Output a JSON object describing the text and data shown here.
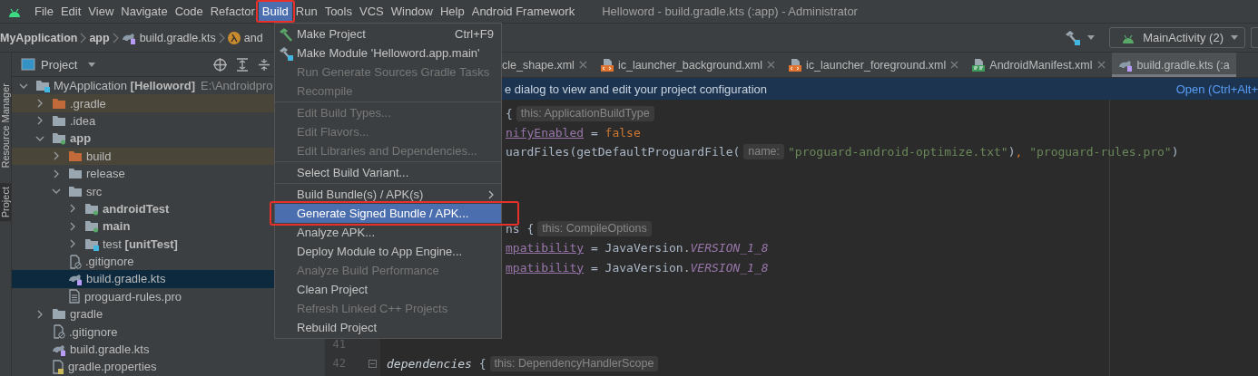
{
  "window": {
    "title": "Helloword - build.gradle.kts (:app) - Administrator"
  },
  "menu_bar": [
    {
      "label": "File",
      "selected": false,
      "annotated": false
    },
    {
      "label": "Edit",
      "selected": false,
      "annotated": false
    },
    {
      "label": "View",
      "selected": false,
      "annotated": false
    },
    {
      "label": "Navigate",
      "selected": false,
      "annotated": false
    },
    {
      "label": "Code",
      "selected": false,
      "annotated": false
    },
    {
      "label": "Refactor",
      "selected": false,
      "annotated": false
    },
    {
      "label": "Build",
      "selected": true,
      "annotated": true
    },
    {
      "label": "Run",
      "selected": false,
      "annotated": false
    },
    {
      "label": "Tools",
      "selected": false,
      "annotated": false
    },
    {
      "label": "VCS",
      "selected": false,
      "annotated": false
    },
    {
      "label": "Window",
      "selected": false,
      "annotated": false
    },
    {
      "label": "Help",
      "selected": false,
      "annotated": false
    },
    {
      "label": "Android Framework",
      "selected": false,
      "annotated": false
    }
  ],
  "breadcrumb": [
    {
      "label": "MyApplication",
      "kind": "project"
    },
    {
      "label": "app",
      "kind": "module"
    },
    {
      "label": "build.gradle.kts",
      "kind": "gradle-script"
    },
    {
      "label": "and",
      "kind": "lambda"
    }
  ],
  "toolbar": {
    "run_config": "MainActivity (2)"
  },
  "side_strip": [
    {
      "label": "Resource Manager",
      "selected": false
    },
    {
      "label": "Project",
      "selected": true
    }
  ],
  "project_panel": {
    "title": "Project",
    "tree": [
      {
        "label": "MyApplication **[Helloword]**",
        "path": "E:\\Androidpro",
        "kind": "project",
        "expanded": true,
        "selected": false,
        "excluded": false,
        "children": [
          {
            "label": ".gradle",
            "kind": "folder",
            "expanded": false,
            "selected": false,
            "excluded": true
          },
          {
            "label": ".idea",
            "kind": "folder",
            "expanded": false,
            "selected": false,
            "excluded": false
          },
          {
            "label": "app",
            "kind": "module",
            "bold": true,
            "expanded": true,
            "selected": false,
            "excluded": false,
            "children": [
              {
                "label": "build",
                "kind": "folder",
                "expanded": false,
                "selected": false,
                "excluded": true
              },
              {
                "label": "release",
                "kind": "folder",
                "expanded": false,
                "selected": false,
                "excluded": false
              },
              {
                "label": "src",
                "kind": "folder",
                "expanded": true,
                "selected": false,
                "excluded": false,
                "children": [
                  {
                    "label": "androidTest",
                    "kind": "source",
                    "bold": true,
                    "expanded": false,
                    "selected": false,
                    "excluded": false
                  },
                  {
                    "label": "main",
                    "kind": "source",
                    "bold": true,
                    "expanded": false,
                    "selected": false,
                    "excluded": false
                  },
                  {
                    "label": "test **[unitTest]**",
                    "kind": "test-source",
                    "expanded": false,
                    "selected": false,
                    "excluded": false
                  }
                ]
              },
              {
                "label": ".gitignore",
                "kind": "gitignore",
                "selected": false,
                "excluded": false
              },
              {
                "label": "build.gradle.kts",
                "kind": "gradle-script",
                "selected": true,
                "excluded": false
              },
              {
                "label": "proguard-rules.pro",
                "kind": "text-file",
                "selected": false,
                "excluded": false
              }
            ]
          },
          {
            "label": "gradle",
            "kind": "folder",
            "expanded": false,
            "selected": false,
            "excluded": false
          },
          {
            "label": ".gitignore",
            "kind": "gitignore",
            "selected": false,
            "excluded": false
          },
          {
            "label": "build.gradle.kts",
            "kind": "gradle-script",
            "selected": false,
            "excluded": false
          },
          {
            "label": "gradle.properties",
            "kind": "properties",
            "selected": false,
            "excluded": false
          }
        ]
      }
    ]
  },
  "editor": {
    "tabs": [
      {
        "label": "cle_shape.xml",
        "kind": "clipped",
        "selected": false,
        "closable": true
      },
      {
        "label": "ic_launcher_background.xml",
        "kind": "xml",
        "selected": false,
        "closable": true
      },
      {
        "label": "ic_launcher_foreground.xml",
        "kind": "xml",
        "selected": false,
        "closable": true
      },
      {
        "label": "AndroidManifest.xml",
        "kind": "manifest",
        "selected": false,
        "closable": true
      },
      {
        "label": "build.gradle.kts (:a",
        "kind": "gradle",
        "selected": true,
        "closable": false
      }
    ],
    "banner": {
      "text": "e dialog to view and edit your project configuration",
      "link": "Open (Ctrl+Alt+"
    },
    "lines": [
      {
        "kind": "clipped",
        "tokens": [
          {
            "kind": "plain",
            "text": "{"
          },
          {
            "kind": "hint",
            "text": "this: ApplicationBuildType"
          }
        ]
      },
      {
        "kind": "clipped",
        "tokens": [
          {
            "kind": "property",
            "text": "nifyEnabled"
          },
          {
            "kind": "plain",
            "text": " = "
          },
          {
            "kind": "keyword",
            "text": "false"
          }
        ]
      },
      {
        "kind": "clipped",
        "tokens": [
          {
            "kind": "plain",
            "text": "uardFiles(getDefaultProguardFile("
          },
          {
            "kind": "hint",
            "text": "name:"
          },
          {
            "kind": "string",
            "text": "\"proguard-android-optimize.txt\""
          },
          {
            "kind": "plain",
            "text": ")"
          },
          {
            "kind": "keyword",
            "text": ", "
          },
          {
            "kind": "string",
            "text": "\"proguard-rules.pro\""
          },
          {
            "kind": "plain",
            "text": ")"
          }
        ]
      },
      {
        "kind": "blank"
      },
      {
        "kind": "blank"
      },
      {
        "kind": "blank"
      },
      {
        "kind": "clipped",
        "tokens": [
          {
            "kind": "plain",
            "text": "ns {"
          },
          {
            "kind": "hint",
            "text": "this: CompileOptions"
          }
        ]
      },
      {
        "kind": "clipped",
        "tokens": [
          {
            "kind": "property",
            "text": "mpatibility"
          },
          {
            "kind": "plain",
            "text": " = JavaVersion."
          },
          {
            "kind": "static",
            "text": "VERSION_1_8"
          }
        ]
      },
      {
        "kind": "clipped",
        "tokens": [
          {
            "kind": "property",
            "text": "mpatibility"
          },
          {
            "kind": "plain",
            "text": " = JavaVersion."
          },
          {
            "kind": "static",
            "text": "VERSION_1_8"
          }
        ]
      },
      {
        "kind": "blank"
      },
      {
        "kind": "blank"
      },
      {
        "kind": "blank"
      },
      {
        "kind": "full",
        "number": "41"
      },
      {
        "kind": "full",
        "number": "42",
        "foldable": true,
        "tokens": [
          {
            "kind": "call",
            "text": "dependencies"
          },
          {
            "kind": "plain",
            "text": " {"
          },
          {
            "kind": "hint",
            "text": "this: DependencyHandlerScope"
          }
        ]
      }
    ]
  },
  "build_menu": {
    "items": [
      {
        "kind": "item",
        "label": "Make Project",
        "shortcut": "Ctrl+F9",
        "disabled": false,
        "selected": false,
        "has_submenu": false
      },
      {
        "kind": "item",
        "label": "Make Module 'Helloword.app.main'",
        "disabled": false,
        "selected": false,
        "has_submenu": false
      },
      {
        "kind": "item",
        "label": "Run Generate Sources Gradle Tasks",
        "disabled": true,
        "selected": false,
        "has_submenu": false
      },
      {
        "kind": "item",
        "label": "Recompile",
        "disabled": true,
        "selected": false,
        "has_submenu": false
      },
      {
        "kind": "separator"
      },
      {
        "kind": "item",
        "label": "Edit Build Types...",
        "disabled": true,
        "selected": false,
        "has_submenu": false
      },
      {
        "kind": "item",
        "label": "Edit Flavors...",
        "disabled": true,
        "selected": false,
        "has_submenu": false
      },
      {
        "kind": "item",
        "label": "Edit Libraries and Dependencies...",
        "disabled": true,
        "selected": false,
        "has_submenu": false
      },
      {
        "kind": "separator"
      },
      {
        "kind": "item",
        "label": "Select Build Variant...",
        "disabled": false,
        "selected": false,
        "has_submenu": false
      },
      {
        "kind": "separator"
      },
      {
        "kind": "item",
        "label": "Build Bundle(s) / APK(s)",
        "disabled": false,
        "selected": false,
        "has_submenu": true
      },
      {
        "kind": "item",
        "label": "Generate Signed Bundle / APK...",
        "disabled": false,
        "selected": true,
        "has_submenu": false,
        "annotated": true
      },
      {
        "kind": "item",
        "label": "Analyze APK...",
        "disabled": false,
        "selected": false,
        "has_submenu": false
      },
      {
        "kind": "item",
        "label": "Deploy Module to App Engine...",
        "disabled": false,
        "selected": false,
        "has_submenu": false
      },
      {
        "kind": "item",
        "label": "Analyze Build Performance",
        "disabled": true,
        "selected": false,
        "has_submenu": false
      },
      {
        "kind": "item",
        "label": "Clean Project",
        "disabled": false,
        "selected": false,
        "has_submenu": false
      },
      {
        "kind": "item",
        "label": "Refresh Linked C++ Projects",
        "disabled": true,
        "selected": false,
        "has_submenu": false
      },
      {
        "kind": "item",
        "label": "Rebuild Project",
        "disabled": false,
        "selected": false,
        "has_submenu": false
      }
    ]
  }
}
